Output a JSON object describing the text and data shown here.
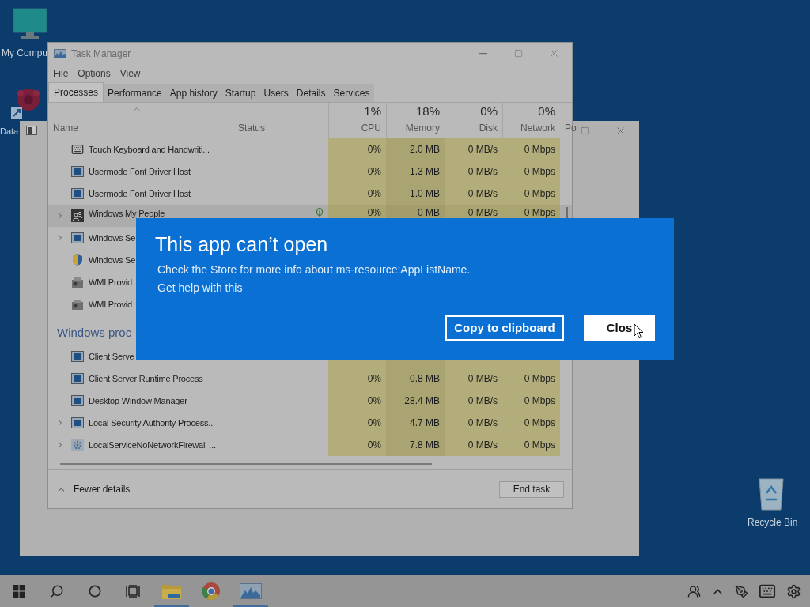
{
  "desktop_icons": [
    {
      "kind": "computer",
      "label": "My Compu"
    },
    {
      "kind": "shortcut",
      "label": "Data"
    },
    {
      "kind": "recycle-bin",
      "label": "Recycle Bin"
    }
  ],
  "task_manager": {
    "title": "Task Manager",
    "menu": [
      "File",
      "Options",
      "View"
    ],
    "tabs": [
      {
        "label": "Processes",
        "selected": true
      },
      {
        "label": "Performance",
        "selected": false
      },
      {
        "label": "App history",
        "selected": false
      },
      {
        "label": "Startup",
        "selected": false
      },
      {
        "label": "Users",
        "selected": false
      },
      {
        "label": "Details",
        "selected": false
      },
      {
        "label": "Services",
        "selected": false
      }
    ],
    "columns": [
      {
        "label": "Name",
        "sorted": true
      },
      {
        "label": "Status",
        "sorted": false
      },
      {
        "usage": "1%",
        "label": "CPU",
        "sorted": false
      },
      {
        "usage": "18%",
        "label": "Memory",
        "sorted": false
      },
      {
        "usage": "0%",
        "label": "Disk",
        "sorted": false
      },
      {
        "usage": "0%",
        "label": "Network",
        "sorted": false
      },
      {
        "label": "Po",
        "sorted": false
      }
    ],
    "rows": [
      {
        "kind": "process",
        "name": "Touch Keyboard and Handwriti...",
        "expandable": false,
        "selected": false,
        "suspended": false,
        "values": [
          "0%",
          "2.0 MB",
          "0 MB/s",
          "0 Mbps"
        ]
      },
      {
        "kind": "process",
        "name": "Usermode Font Driver Host",
        "expandable": false,
        "selected": false,
        "suspended": false,
        "values": [
          "0%",
          "1.3 MB",
          "0 MB/s",
          "0 Mbps"
        ]
      },
      {
        "kind": "process",
        "name": "Usermode Font Driver Host",
        "expandable": false,
        "selected": false,
        "suspended": false,
        "values": [
          "0%",
          "1.0 MB",
          "0 MB/s",
          "0 Mbps"
        ]
      },
      {
        "kind": "process",
        "name": "Windows My People",
        "expandable": true,
        "selected": true,
        "suspended": true,
        "values": [
          "0%",
          "0 MB",
          "0 MB/s",
          "0 Mbps"
        ]
      },
      {
        "kind": "process",
        "name": "Windows Se",
        "expandable": true,
        "selected": false,
        "suspended": false
      },
      {
        "kind": "process",
        "name": "Windows Se",
        "expandable": false,
        "selected": false,
        "suspended": false
      },
      {
        "kind": "process",
        "name": "WMI Provid",
        "expandable": false,
        "selected": false,
        "suspended": false
      },
      {
        "kind": "process",
        "name": "WMI Provid",
        "expandable": false,
        "selected": false,
        "suspended": false
      },
      {
        "kind": "group",
        "name": "Windows proc"
      },
      {
        "kind": "process",
        "name": "Client Serve",
        "expandable": false,
        "selected": false,
        "suspended": false
      },
      {
        "kind": "process",
        "name": "Client Server Runtime Process",
        "expandable": false,
        "selected": false,
        "suspended": false,
        "values": [
          "0%",
          "0.8 MB",
          "0 MB/s",
          "0 Mbps"
        ]
      },
      {
        "kind": "process",
        "name": "Desktop Window Manager",
        "expandable": false,
        "selected": false,
        "suspended": false,
        "values": [
          "0%",
          "28.4 MB",
          "0 MB/s",
          "0 Mbps"
        ]
      },
      {
        "kind": "process",
        "name": "Local Security Authority Process...",
        "expandable": true,
        "selected": false,
        "suspended": false,
        "values": [
          "0%",
          "4.7 MB",
          "0 MB/s",
          "0 Mbps"
        ]
      },
      {
        "kind": "process",
        "name": "LocalServiceNoNetworkFirewall ...",
        "expandable": true,
        "selected": false,
        "suspended": false,
        "values": [
          "0%",
          "7.8 MB",
          "0 MB/s",
          "0 Mbps"
        ]
      }
    ],
    "footer": {
      "toggle": "Fewer details",
      "button": "End task"
    }
  },
  "dialog": {
    "title": "This app can’t open",
    "message": "Check the Store for more info about ms-resource:AppListName.",
    "link": "Get help with this",
    "buttons": [
      {
        "label": "Copy to clipboard",
        "primary": false
      },
      {
        "label": "Clos",
        "primary": true
      }
    ]
  },
  "taskbar": {
    "apps": [
      {
        "kind": "folder",
        "running": true
      },
      {
        "kind": "chrome",
        "running": false
      },
      {
        "kind": "task-manager",
        "running": true
      }
    ]
  }
}
